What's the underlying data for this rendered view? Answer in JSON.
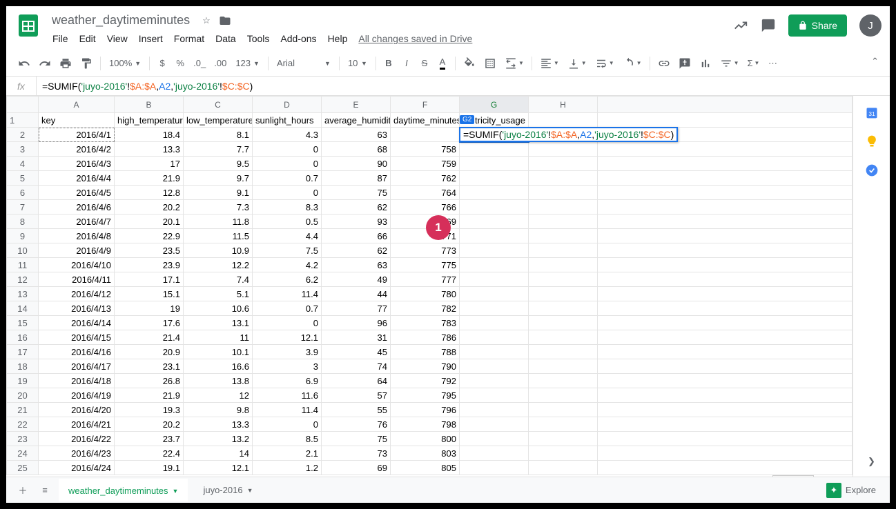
{
  "doc_title": "weather_daytimeminutes",
  "avatar_initial": "J",
  "menubar": [
    "File",
    "Edit",
    "View",
    "Insert",
    "Format",
    "Data",
    "Tools",
    "Add-ons",
    "Help"
  ],
  "save_status": "All changes saved in Drive",
  "share_label": "Share",
  "toolbar": {
    "zoom": "100%",
    "font": "Arial",
    "fontsize": "10",
    "numfmt": "123"
  },
  "formula_parts": {
    "prefix": "=SUMIF(",
    "s1": "'juyo-2016'",
    "b1": "!",
    "r1": "$A:$A",
    "c1": ",",
    "r2": "A2",
    "c2": ",",
    "s2": "'juyo-2016'",
    "b2": "!",
    "r3": "$C:$C",
    "suffix": ")"
  },
  "active_cell_ref": "G2",
  "columns": [
    "A",
    "B",
    "C",
    "D",
    "E",
    "F",
    "G",
    "H"
  ],
  "headers": [
    "key",
    "high_temperature",
    "low_temperature",
    "sunlight_hours",
    "average_humidit",
    "daytime_minutes",
    "electricity_usage",
    ""
  ],
  "partial_header": "tricity_usage",
  "rows": [
    {
      "n": 2,
      "key": "2016/4/1",
      "high": "18.4",
      "low": "8.1",
      "sun": "4.3",
      "hum": "63"
    },
    {
      "n": 3,
      "key": "2016/4/2",
      "high": "13.3",
      "low": "7.7",
      "sun": "0",
      "hum": "68",
      "day": "758"
    },
    {
      "n": 4,
      "key": "2016/4/3",
      "high": "17",
      "low": "9.5",
      "sun": "0",
      "hum": "90",
      "day": "759"
    },
    {
      "n": 5,
      "key": "2016/4/4",
      "high": "21.9",
      "low": "9.7",
      "sun": "0.7",
      "hum": "87",
      "day": "762"
    },
    {
      "n": 6,
      "key": "2016/4/5",
      "high": "12.8",
      "low": "9.1",
      "sun": "0",
      "hum": "75",
      "day": "764"
    },
    {
      "n": 7,
      "key": "2016/4/6",
      "high": "20.2",
      "low": "7.3",
      "sun": "8.3",
      "hum": "62",
      "day": "766"
    },
    {
      "n": 8,
      "key": "2016/4/7",
      "high": "20.1",
      "low": "11.8",
      "sun": "0.5",
      "hum": "93",
      "day": "769"
    },
    {
      "n": 9,
      "key": "2016/4/8",
      "high": "22.9",
      "low": "11.5",
      "sun": "4.4",
      "hum": "66",
      "day": "771"
    },
    {
      "n": 10,
      "key": "2016/4/9",
      "high": "23.5",
      "low": "10.9",
      "sun": "7.5",
      "hum": "62",
      "day": "773"
    },
    {
      "n": 11,
      "key": "2016/4/10",
      "high": "23.9",
      "low": "12.2",
      "sun": "4.2",
      "hum": "63",
      "day": "775"
    },
    {
      "n": 12,
      "key": "2016/4/11",
      "high": "17.1",
      "low": "7.4",
      "sun": "6.2",
      "hum": "49",
      "day": "777"
    },
    {
      "n": 13,
      "key": "2016/4/12",
      "high": "15.1",
      "low": "5.1",
      "sun": "11.4",
      "hum": "44",
      "day": "780"
    },
    {
      "n": 14,
      "key": "2016/4/13",
      "high": "19",
      "low": "10.6",
      "sun": "0.7",
      "hum": "77",
      "day": "782"
    },
    {
      "n": 15,
      "key": "2016/4/14",
      "high": "17.6",
      "low": "13.1",
      "sun": "0",
      "hum": "96",
      "day": "783"
    },
    {
      "n": 16,
      "key": "2016/4/15",
      "high": "21.4",
      "low": "11",
      "sun": "12.1",
      "hum": "31",
      "day": "786"
    },
    {
      "n": 17,
      "key": "2016/4/16",
      "high": "20.9",
      "low": "10.1",
      "sun": "3.9",
      "hum": "45",
      "day": "788"
    },
    {
      "n": 18,
      "key": "2016/4/17",
      "high": "23.1",
      "low": "16.6",
      "sun": "3",
      "hum": "74",
      "day": "790"
    },
    {
      "n": 19,
      "key": "2016/4/18",
      "high": "26.8",
      "low": "13.8",
      "sun": "6.9",
      "hum": "64",
      "day": "792"
    },
    {
      "n": 20,
      "key": "2016/4/19",
      "high": "21.9",
      "low": "12",
      "sun": "11.6",
      "hum": "57",
      "day": "795"
    },
    {
      "n": 21,
      "key": "2016/4/20",
      "high": "19.3",
      "low": "9.8",
      "sun": "11.4",
      "hum": "55",
      "day": "796"
    },
    {
      "n": 22,
      "key": "2016/4/21",
      "high": "20.2",
      "low": "13.3",
      "sun": "0",
      "hum": "76",
      "day": "798"
    },
    {
      "n": 23,
      "key": "2016/4/22",
      "high": "23.7",
      "low": "13.2",
      "sun": "8.5",
      "hum": "75",
      "day": "800"
    },
    {
      "n": 24,
      "key": "2016/4/23",
      "high": "22.4",
      "low": "14",
      "sun": "2.1",
      "hum": "73",
      "day": "803"
    },
    {
      "n": 25,
      "key": "2016/4/24",
      "high": "19.1",
      "low": "12.1",
      "sun": "1.2",
      "hum": "69",
      "day": "805"
    }
  ],
  "badge": "1",
  "sheets": {
    "active": "weather_daytimeminutes",
    "other": "juyo-2016"
  },
  "explore": "Explore"
}
